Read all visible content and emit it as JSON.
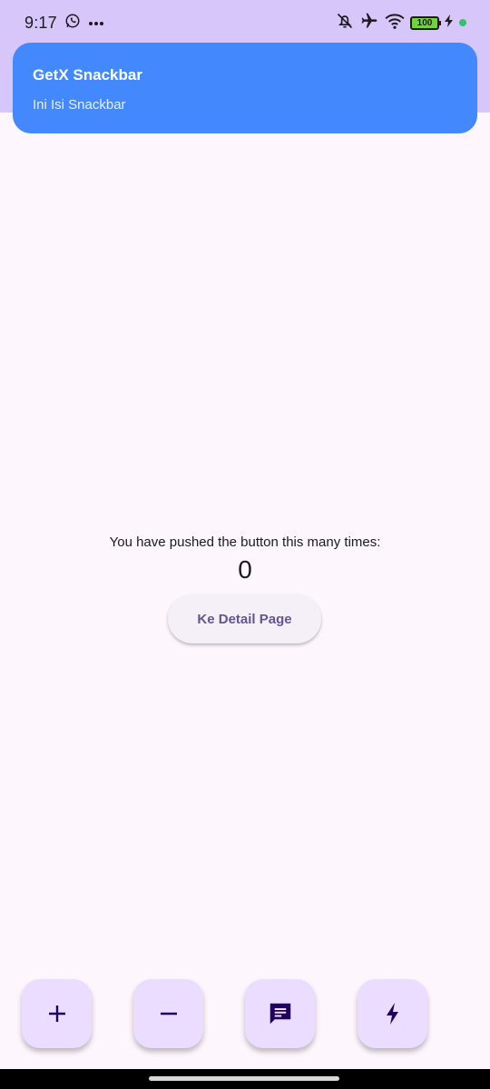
{
  "status_bar": {
    "time": "9:17",
    "battery": "100"
  },
  "snackbar": {
    "title": "GetX Snackbar",
    "message": "Ini Isi Snackbar"
  },
  "main": {
    "counter_label": "You have pushed the button this many times:",
    "counter_value": "0",
    "detail_button_label": "Ke Detail Page"
  },
  "fabs": [
    {
      "icon": "add-icon"
    },
    {
      "icon": "remove-icon"
    },
    {
      "icon": "message-icon"
    },
    {
      "icon": "flash-icon"
    }
  ],
  "colors": {
    "app_bar": "#d7c6f9",
    "snackbar_bg": "#4388fd",
    "background": "#fdf6fd",
    "fab_bg": "#eaddff",
    "button_text": "#65558f"
  }
}
